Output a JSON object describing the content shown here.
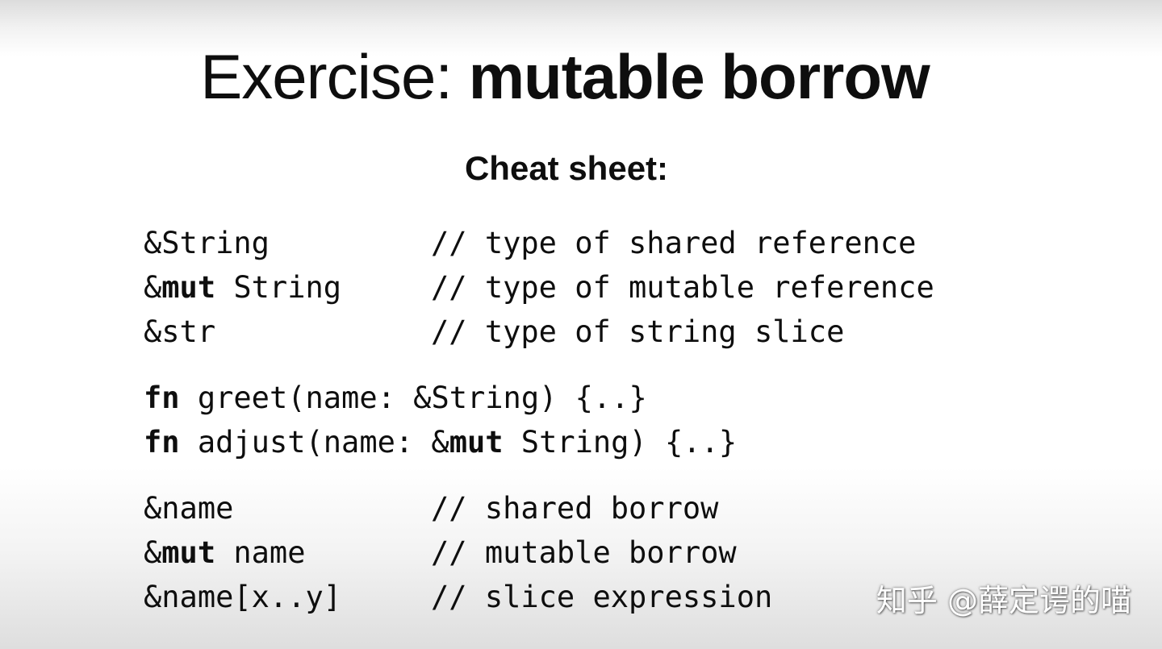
{
  "slide": {
    "title_regular": "Exercise: ",
    "title_bold": "mutable borrow",
    "subtitle": "Cheat sheet:"
  },
  "types": [
    {
      "prefix": "&",
      "keyword": "",
      "rest": "String",
      "comment": "// type of shared reference"
    },
    {
      "prefix": "&",
      "keyword": "mut",
      "rest": " String",
      "comment": "// type of mutable reference"
    },
    {
      "prefix": "&",
      "keyword": "",
      "rest": "str",
      "comment": "// type of string slice"
    }
  ],
  "functions": [
    {
      "keyword": "fn",
      "before": " greet(name: &",
      "keyword2": "",
      "after": "String) {..}"
    },
    {
      "keyword": "fn",
      "before": " adjust(name: &",
      "keyword2": "mut",
      "after": " String) {..}"
    }
  ],
  "borrows": [
    {
      "prefix": "&",
      "keyword": "",
      "rest": "name",
      "comment": "// shared borrow"
    },
    {
      "prefix": "&",
      "keyword": "mut",
      "rest": " name",
      "comment": "// mutable borrow"
    },
    {
      "prefix": "&",
      "keyword": "",
      "rest": "name[x..y]",
      "comment": "// slice expression"
    }
  ],
  "watermark": "知乎 @薛定谔的喵"
}
